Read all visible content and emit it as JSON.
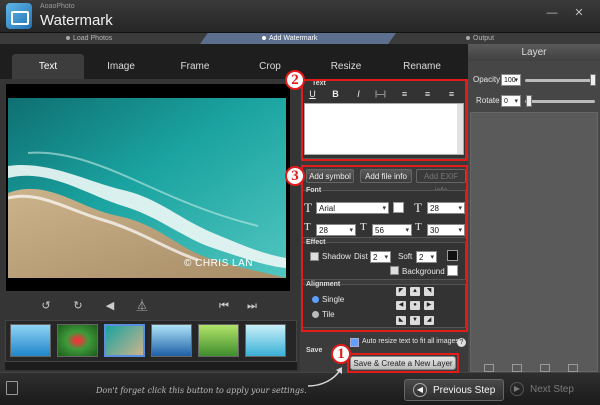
{
  "app": {
    "subtitle": "AoaoPhoto",
    "title": "Watermark"
  },
  "steps": [
    "Load Photos",
    "Add Watermark",
    "Output"
  ],
  "tabs": [
    "Text",
    "Image",
    "Frame",
    "Crop",
    "Resize",
    "Rename"
  ],
  "active_tab": "Text",
  "preview": {
    "watermark_text": "© CHRIS LAN"
  },
  "text_section": {
    "title": "Text",
    "format_buttons": [
      "U",
      "B",
      "I",
      "|—|",
      "align-left",
      "align-center",
      "align-right"
    ]
  },
  "buttons": {
    "add_symbol": "Add symbol",
    "add_file_info": "Add file info",
    "add_exif_info": "Add EXIF info"
  },
  "font_section": {
    "title": "Font",
    "family": "Arial",
    "size": "28",
    "width": "28",
    "height": "56",
    "spacing": "30"
  },
  "effect_section": {
    "title": "Effect",
    "shadow_label": "Shadow",
    "dist_label": "Dist",
    "dist_value": "2",
    "soft_label": "Soft",
    "soft_value": "2",
    "background_label": "Background"
  },
  "alignment_section": {
    "title": "Alignment",
    "options": [
      "Single",
      "Tile"
    ],
    "selected": "Single"
  },
  "auto_resize_label": "Auto resize text to fit all images",
  "save_label": "Save",
  "save_create_button": "Save & Create a New Layer",
  "layer_panel": {
    "title": "Layer",
    "opacity_label": "Opacity",
    "opacity_value": "100",
    "rotate_label": "Rotate",
    "rotate_value": "0"
  },
  "hint_text": "Don't forget click this button to apply your settings.",
  "nav": {
    "previous": "Previous Step",
    "next": "Next Step"
  },
  "annotations": {
    "badge_1": "1",
    "badge_2": "2",
    "badge_3": "3",
    "color": "#e21b1b"
  },
  "colors": {
    "accent_step": "#5d6f8f",
    "annotation": "#e21b1b"
  }
}
